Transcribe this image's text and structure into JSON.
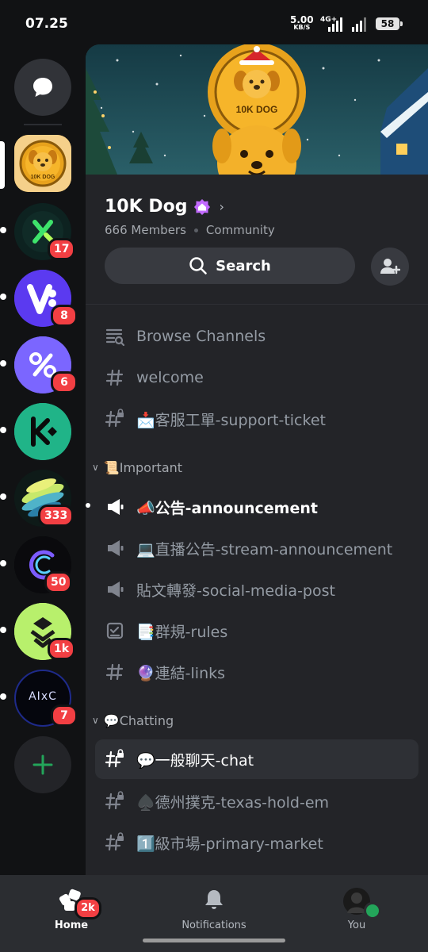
{
  "status_bar": {
    "time": "07.25",
    "net_speed": "5.00",
    "net_speed_unit": "KB/S",
    "network_type": "4G+",
    "battery": "58"
  },
  "server_rail": {
    "servers": [
      {
        "name": "10K Dog",
        "badge": ""
      },
      {
        "name": "server-x",
        "badge": "17"
      },
      {
        "name": "server-v",
        "badge": "8"
      },
      {
        "name": "server-percent",
        "badge": "6"
      },
      {
        "name": "KuCoin",
        "badge": ""
      },
      {
        "name": "server-globe",
        "badge": "333"
      },
      {
        "name": "server-c",
        "badge": "50"
      },
      {
        "name": "server-layers",
        "badge": "1k"
      },
      {
        "name": "AIxC",
        "badge": "7",
        "logo_text": "AIxC"
      }
    ]
  },
  "server": {
    "banner_logo_text": "10K DOG",
    "name": "10K Dog",
    "members": "666 Members",
    "community": "Community",
    "search_label": "Search"
  },
  "channels": {
    "top": [
      {
        "icon": "browse-icon",
        "label": "Browse Channels"
      },
      {
        "icon": "hash-icon",
        "label": "welcome"
      },
      {
        "icon": "locked-hash-icon",
        "label": "📩客服工單-support-ticket"
      }
    ],
    "categories": [
      {
        "name": "📜Important",
        "channels": [
          {
            "icon": "announcement-icon",
            "label": "📣公告-announcement",
            "unread": true
          },
          {
            "icon": "announcement-icon",
            "label": "💻直播公告-stream-announcement"
          },
          {
            "icon": "announcement-icon",
            "label": "貼文轉發-social-media-post"
          },
          {
            "icon": "rules-icon",
            "label": "📑群規-rules"
          },
          {
            "icon": "hash-icon",
            "label": "🔮連結-links"
          }
        ]
      },
      {
        "name": "💬Chatting",
        "channels": [
          {
            "icon": "locked-hash-icon",
            "label": "💬一般聊天-chat",
            "selected": true
          },
          {
            "icon": "locked-hash-icon",
            "label": "♠️德州撲克-texas-hold-em"
          },
          {
            "icon": "locked-hash-icon",
            "label": "1️⃣級市場-primary-market"
          }
        ]
      }
    ]
  },
  "bottom_nav": {
    "home_label": "Home",
    "home_badge": "2k",
    "notifications_label": "Notifications",
    "you_label": "You"
  },
  "colors": {
    "accent_red": "#f23f43",
    "online_green": "#23a55a",
    "panel_bg": "#232428",
    "rail_bg": "#111214"
  }
}
